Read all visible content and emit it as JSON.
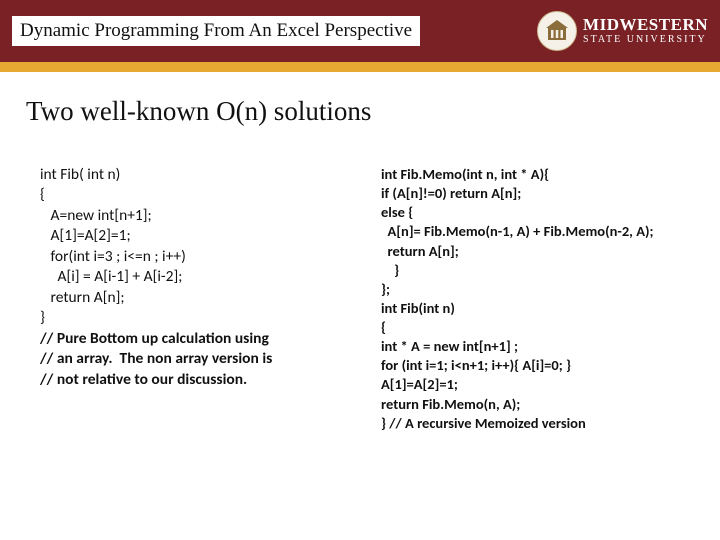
{
  "header": {
    "title": "Dynamic Programming From An Excel Perspective",
    "logo": {
      "line1": "MIDWESTERN",
      "line2": "STATE UNIVERSITY"
    }
  },
  "slide": {
    "title": "Two well-known O(n) solutions"
  },
  "code_left": {
    "l1": "int Fib( int n)",
    "l2": "{",
    "l3": "   A=new int[n+1];",
    "l4": "   A[1]=A[2]=1;",
    "l5": "   for(int i=3 ; i<=n ; i++)",
    "l6": "     A[i] = A[i-1] + A[i-2];",
    "l7": "   return A[n];",
    "l8": "}",
    "c1": "// Pure Bottom up calculation using",
    "c2": "// an array.  The non array version is",
    "c3": "// not relative to our discussion."
  },
  "code_right": {
    "l1": "int Fib.Memo(int n, int * A){",
    "l2": "if (A[n]!=0) return A[n];",
    "l3": "else {",
    "l4": "  A[n]= Fib.Memo(n-1, A) + Fib.Memo(n-2, A);",
    "l5": "  return A[n];",
    "l6": "    }",
    "l7": "};",
    "l8": "int Fib(int n)",
    "l9": "{",
    "l10": "int * A = new int[n+1] ;",
    "l11": "for (int i=1; i<n+1; i++){ A[i]=0; }",
    "l12": "A[1]=A[2]=1;",
    "l13": "return Fib.Memo(n, A);",
    "l14": "} // A recursive Memoized version"
  }
}
